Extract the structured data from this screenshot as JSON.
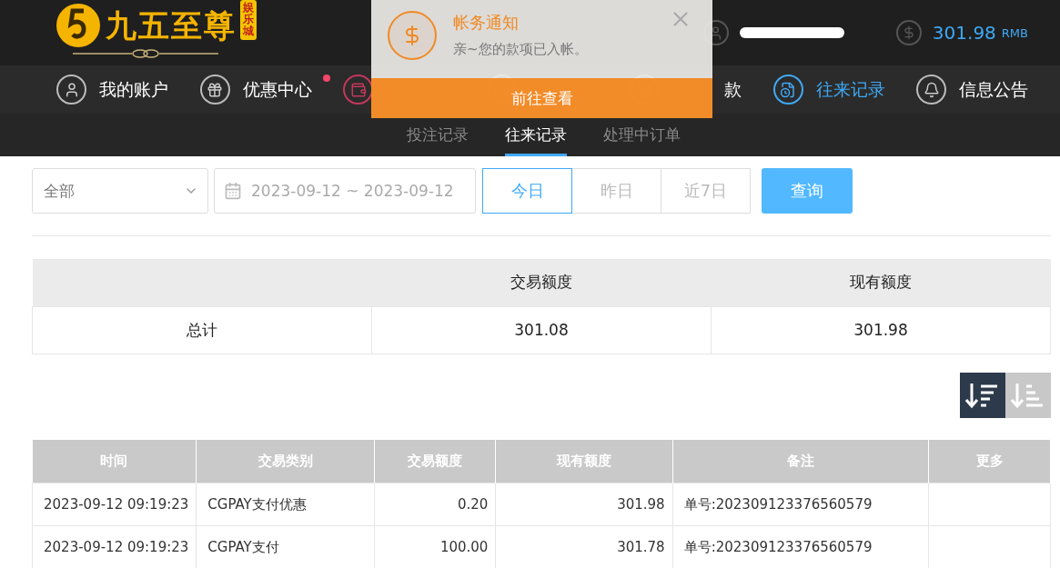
{
  "brand": {
    "name": "九五至尊",
    "tag": "娱乐城"
  },
  "account": {
    "balance": "301.98",
    "currency": "RMB"
  },
  "nav": [
    {
      "label": "我的账户",
      "kind": "user",
      "selected": false,
      "dot": false
    },
    {
      "label": "优惠中心",
      "kind": "gift",
      "selected": false,
      "dot": true
    },
    {
      "kind": "wallet"
    },
    {
      "kind": "deposit"
    },
    {
      "label": "款",
      "kind": "withdraw",
      "selected": false,
      "dot": false
    },
    {
      "label": "往来记录",
      "kind": "records",
      "selected": true,
      "dot": false
    },
    {
      "label": "信息公告",
      "kind": "bell",
      "selected": false,
      "dot": false
    }
  ],
  "subtabs": [
    {
      "label": "投注记录",
      "selected": false
    },
    {
      "label": "往来记录",
      "selected": true
    },
    {
      "label": "处理中订单",
      "selected": false
    }
  ],
  "notification": {
    "title": "帐务通知",
    "message": "亲~您的款项已入帐。",
    "action": "前往查看"
  },
  "filters": {
    "type": "全部",
    "date_range": "2023-09-12 ~ 2023-09-12",
    "quick": [
      {
        "label": "今日",
        "selected": true
      },
      {
        "label": "昨日",
        "selected": false
      },
      {
        "label": "近7日",
        "selected": false
      }
    ],
    "search": "查询"
  },
  "summary": {
    "columns": [
      "交易额度",
      "现有额度"
    ],
    "row": {
      "label": "总计",
      "values": [
        "301.08",
        "301.98"
      ]
    }
  },
  "sort": [
    {
      "kind": "desc",
      "selected": true
    },
    {
      "kind": "asc",
      "selected": false
    }
  ],
  "table": {
    "columns": [
      "时间",
      "交易类别",
      "交易额度",
      "现有额度",
      "备注",
      "更多"
    ],
    "rows": [
      [
        "2023-09-12 09:19:23",
        "CGPAY支付优惠",
        "0.20",
        "301.98",
        "单号:202309123376560579",
        ""
      ],
      [
        "2023-09-12 09:19:23",
        "CGPAY支付",
        "100.00",
        "301.78",
        "单号:202309123376560579",
        ""
      ]
    ]
  }
}
